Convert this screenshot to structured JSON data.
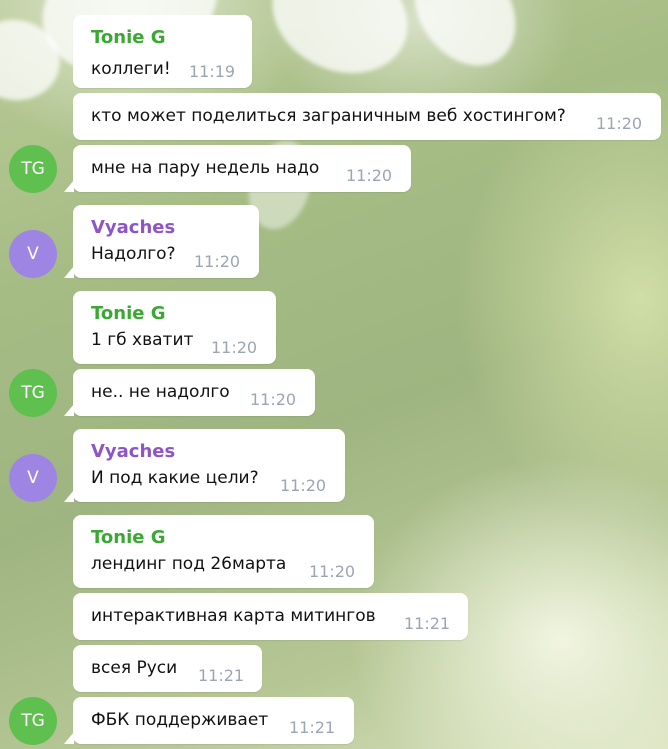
{
  "colors": {
    "tonie": "#3aa833",
    "vyaches": "#8e55c7",
    "avatar_tg": "#5fbf4f",
    "avatar_v": "#9f85e3",
    "time": "#9aa6b2"
  },
  "messages": [
    {
      "sender": "Tonie G",
      "text": "коллеги!",
      "time": "11:19"
    },
    {
      "sender": "",
      "text": "кто может поделиться заграничным веб хостингом?",
      "time": "11:20"
    },
    {
      "sender": "",
      "text": "мне на пару недель надо",
      "time": "11:20",
      "avatar": "TG"
    },
    {
      "sender": "Vyaches",
      "text": "Надолго?",
      "time": "11:20",
      "avatar": "V"
    },
    {
      "sender": "Tonie G",
      "text": "1 гб хватит",
      "time": "11:20"
    },
    {
      "sender": "",
      "text": "не.. не надолго",
      "time": "11:20",
      "avatar": "TG"
    },
    {
      "sender": "Vyaches",
      "text": "И под какие цели?",
      "time": "11:20",
      "avatar": "V"
    },
    {
      "sender": "Tonie G",
      "text": "лендинг под 26марта",
      "time": "11:20"
    },
    {
      "sender": "",
      "text": "интерактивная карта митингов",
      "time": "11:21"
    },
    {
      "sender": "",
      "text": "всея Руси",
      "time": "11:21"
    },
    {
      "sender": "",
      "text": "ФБК поддерживает",
      "time": "11:21",
      "avatar": "TG"
    }
  ]
}
